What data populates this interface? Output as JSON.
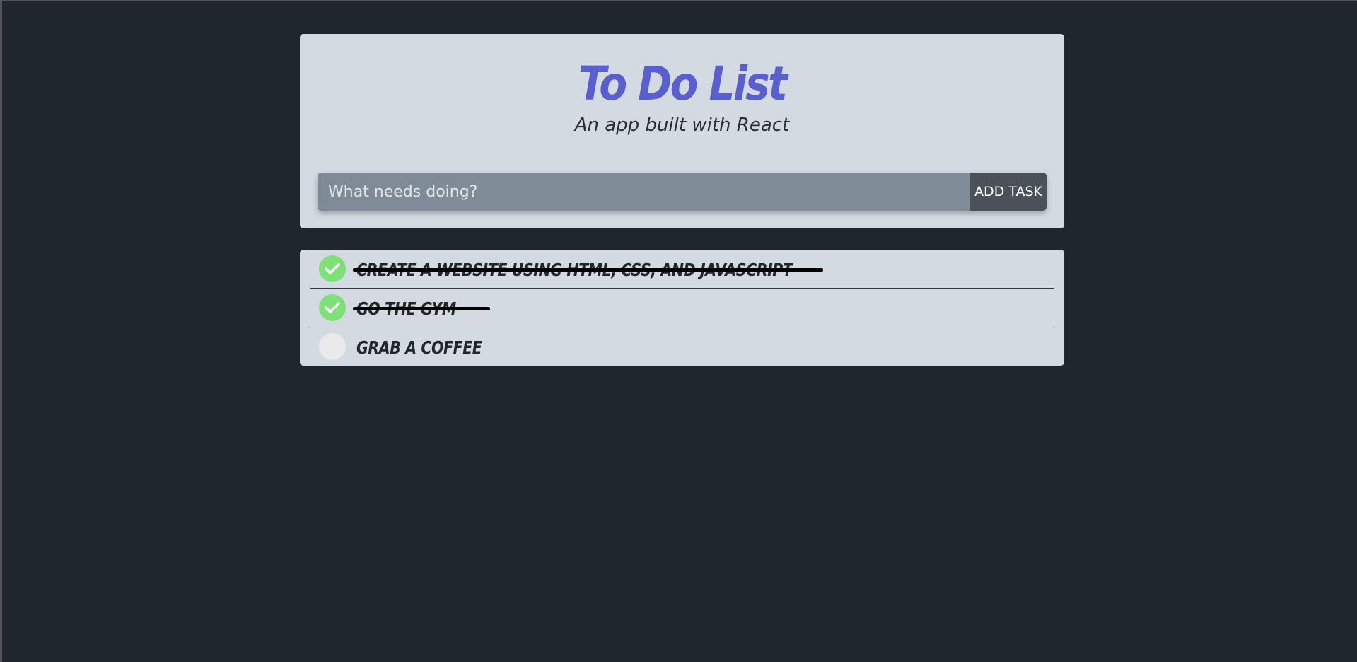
{
  "header": {
    "title": "To Do List",
    "subtitle": "An app built with React"
  },
  "form": {
    "placeholder": "What needs doing?",
    "add_label": "ADD TASK"
  },
  "tasks": [
    {
      "text": "Create a website using HTML, CSS, and Javascript",
      "completed": true
    },
    {
      "text": "Go the gym",
      "completed": true
    },
    {
      "text": "Grab a coffee",
      "completed": false
    }
  ],
  "colors": {
    "background": "#20262e",
    "card": "#d3dae2",
    "title": "#5a5fd0",
    "input": "#7f8c97",
    "button": "#4a5158",
    "check": "#7fe07a"
  },
  "icons": {
    "completed": "check-icon",
    "incomplete": "empty-circle-icon"
  }
}
